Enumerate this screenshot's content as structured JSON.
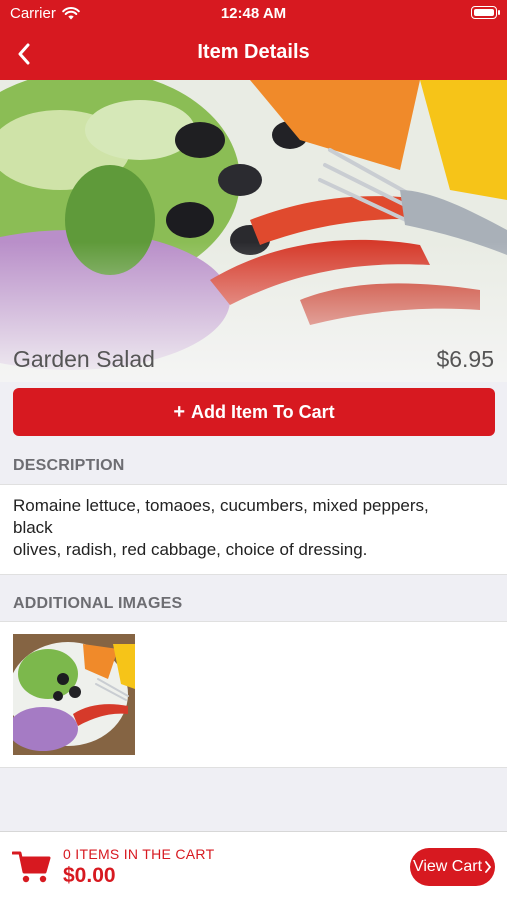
{
  "status_bar": {
    "carrier": "Carrier",
    "time": "12:48 AM"
  },
  "nav": {
    "title": "Item Details"
  },
  "item": {
    "name": "Garden Salad",
    "price": "$6.95"
  },
  "actions": {
    "add_to_cart_label": "Add Item To Cart"
  },
  "description": {
    "header": "DESCRIPTION",
    "lines": [
      "Romaine lettuce, tomaoes, cucumbers, mixed peppers,",
      "black",
      "olives, radish, red cabbage, choice of dressing."
    ]
  },
  "additional_images": {
    "header": "ADDITIONAL IMAGES"
  },
  "cart": {
    "count_label": "0 ITEMS IN THE CART",
    "total": "$0.00",
    "view_cart_label": "View Cart"
  },
  "colors": {
    "brand": "#d71920",
    "section_bg": "#efeff4",
    "section_text": "#6d6d72"
  },
  "icons": [
    "wifi-icon",
    "battery-icon",
    "back-chevron-icon",
    "plus-icon",
    "cart-icon",
    "chevron-right-icon"
  ]
}
